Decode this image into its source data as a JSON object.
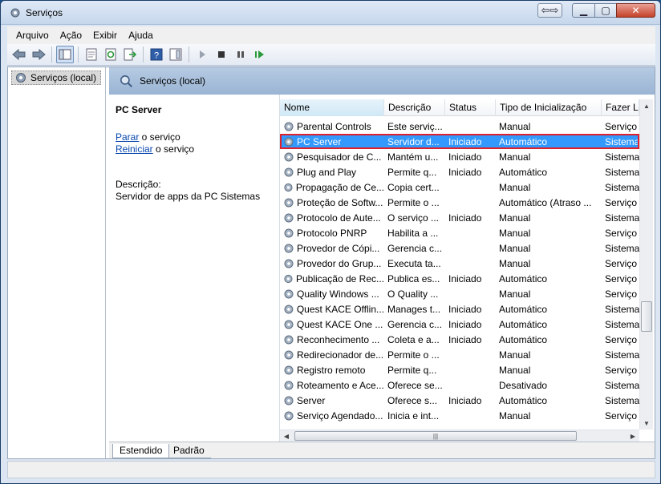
{
  "window": {
    "title": "Serviços"
  },
  "menu": [
    "Arquivo",
    "Ação",
    "Exibir",
    "Ajuda"
  ],
  "tree": {
    "root_label": "Serviços (local)"
  },
  "pane": {
    "header_title": "Serviços (local)"
  },
  "description": {
    "service_name": "PC Server",
    "stop_link": "Parar",
    "stop_suffix": " o serviço",
    "restart_link": "Reiniciar",
    "restart_suffix": " o serviço",
    "desc_label": "Descrição:",
    "desc_text": "Servidor de apps da PC Sistemas"
  },
  "columns": [
    "Nome",
    "Descrição",
    "Status",
    "Tipo de Inicialização",
    "Fazer Lo"
  ],
  "rows": [
    {
      "name": "Parental Controls",
      "desc": "Este serviç...",
      "status": "",
      "type": "Manual",
      "logon": "Serviço"
    },
    {
      "name": "PC Server",
      "desc": "Servidor d...",
      "status": "Iniciado",
      "type": "Automático",
      "logon": "Sistema"
    },
    {
      "name": "Pesquisador de C...",
      "desc": "Mantém u...",
      "status": "Iniciado",
      "type": "Manual",
      "logon": "Sistema"
    },
    {
      "name": "Plug and Play",
      "desc": "Permite q...",
      "status": "Iniciado",
      "type": "Automático",
      "logon": "Sistema"
    },
    {
      "name": "Propagação de Ce...",
      "desc": "Copia cert...",
      "status": "",
      "type": "Manual",
      "logon": "Sistema"
    },
    {
      "name": "Proteção de Softw...",
      "desc": "Permite o ...",
      "status": "",
      "type": "Automático (Atraso ...",
      "logon": "Serviço"
    },
    {
      "name": "Protocolo de Aute...",
      "desc": "O serviço ...",
      "status": "Iniciado",
      "type": "Manual",
      "logon": "Sistema"
    },
    {
      "name": "Protocolo PNRP",
      "desc": "Habilita a ...",
      "status": "",
      "type": "Manual",
      "logon": "Serviço"
    },
    {
      "name": "Provedor de Cópi...",
      "desc": "Gerencia c...",
      "status": "",
      "type": "Manual",
      "logon": "Sistema"
    },
    {
      "name": "Provedor do Grup...",
      "desc": "Executa ta...",
      "status": "",
      "type": "Manual",
      "logon": "Serviço"
    },
    {
      "name": "Publicação de Rec...",
      "desc": "Publica es...",
      "status": "Iniciado",
      "type": "Automático",
      "logon": "Serviço"
    },
    {
      "name": "Quality Windows ...",
      "desc": "O Quality ...",
      "status": "",
      "type": "Manual",
      "logon": "Serviço"
    },
    {
      "name": "Quest KACE Offlin...",
      "desc": "Manages t...",
      "status": "Iniciado",
      "type": "Automático",
      "logon": "Sistema"
    },
    {
      "name": "Quest KACE One ...",
      "desc": "Gerencia c...",
      "status": "Iniciado",
      "type": "Automático",
      "logon": "Sistema"
    },
    {
      "name": "Reconhecimento ...",
      "desc": "Coleta e a...",
      "status": "Iniciado",
      "type": "Automático",
      "logon": "Serviço"
    },
    {
      "name": "Redirecionador de...",
      "desc": "Permite o ...",
      "status": "",
      "type": "Manual",
      "logon": "Sistema"
    },
    {
      "name": "Registro remoto",
      "desc": "Permite q...",
      "status": "",
      "type": "Manual",
      "logon": "Serviço"
    },
    {
      "name": "Roteamento e Ace...",
      "desc": "Oferece se...",
      "status": "",
      "type": "Desativado",
      "logon": "Sistema"
    },
    {
      "name": "Server",
      "desc": "Oferece s...",
      "status": "Iniciado",
      "type": "Automático",
      "logon": "Sistema"
    },
    {
      "name": "Serviço Agendado...",
      "desc": "Inicia e int...",
      "status": "",
      "type": "Manual",
      "logon": "Serviço"
    }
  ],
  "selected_index": 1,
  "tabs": [
    "Estendido",
    "Padrão"
  ],
  "colors": {
    "selection": "#3399ff",
    "highlight_border": "#e0202a",
    "link": "#0645ad"
  }
}
